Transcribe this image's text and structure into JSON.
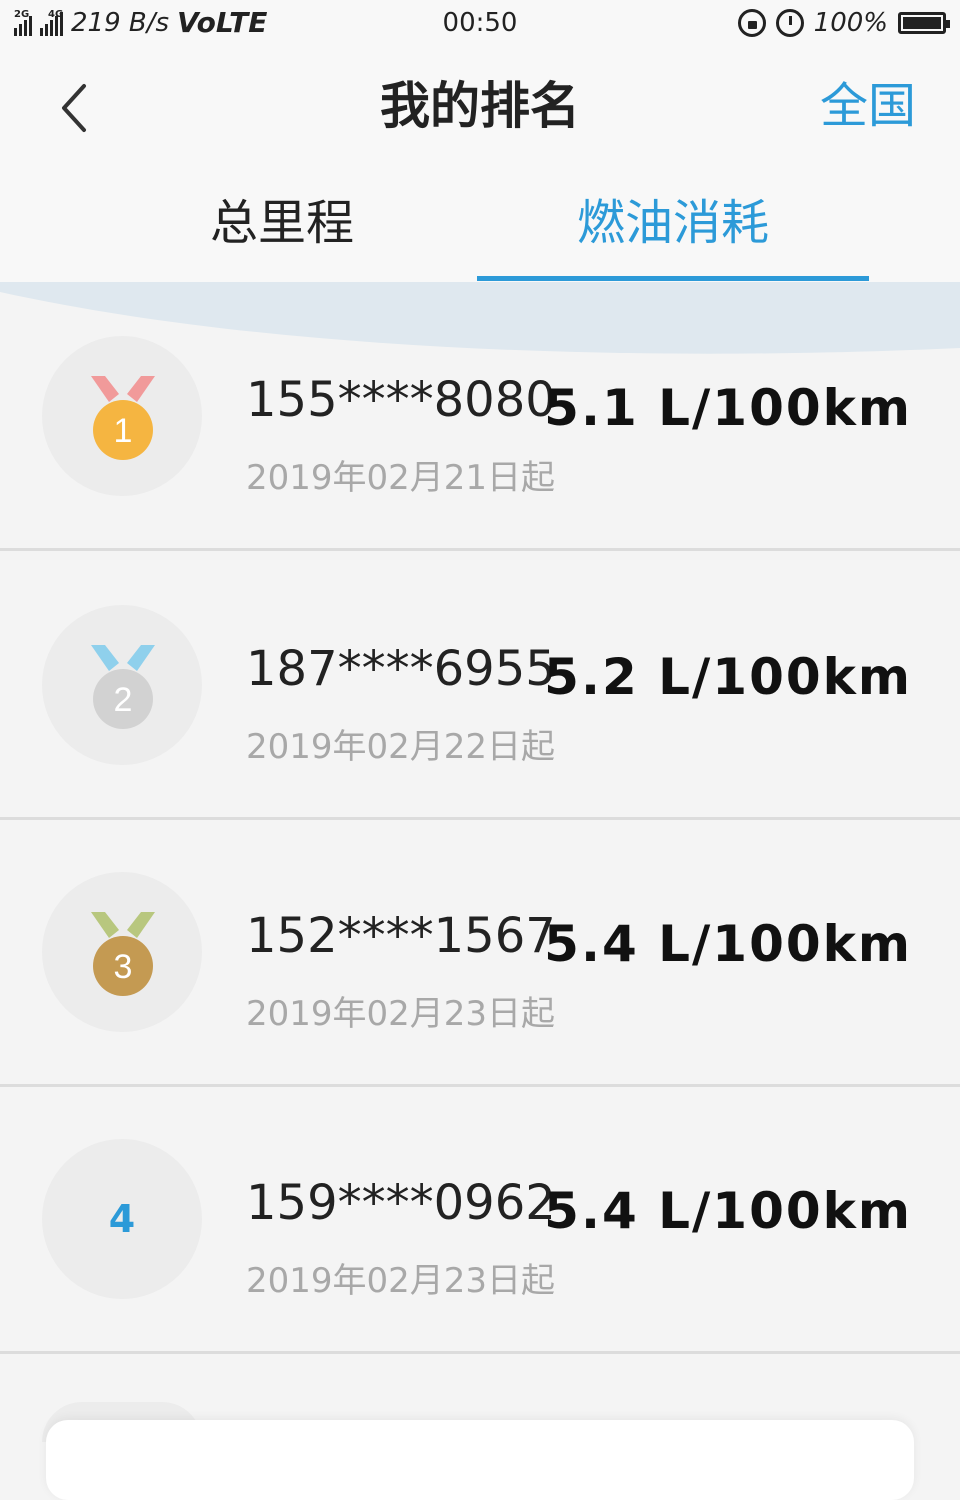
{
  "status_bar": {
    "network_labels": [
      "2G",
      "4G"
    ],
    "speed": "219 B/s",
    "volte": "VoLTE",
    "time": "00:50",
    "battery": "100%",
    "battery_level": 1.0
  },
  "header": {
    "back_icon": "chevron-left-icon",
    "title": "我的排名",
    "region_label": "全国"
  },
  "tabs": [
    {
      "label": "总里程",
      "active": false
    },
    {
      "label": "燃油消耗",
      "active": true
    }
  ],
  "colors": {
    "accent": "#2c9ad8",
    "gold": "#f5b541",
    "silver": "#d2d2d2",
    "bronze": "#c49a52"
  },
  "rankings": [
    {
      "rank": "1",
      "medal": "gold-medal-icon",
      "phone": "155****8080",
      "usage": "5.1 L/100km",
      "since": "2019年02月21日起"
    },
    {
      "rank": "2",
      "medal": "silver-medal-icon",
      "phone": "187****6955",
      "usage": "5.2 L/100km",
      "since": "2019年02月22日起"
    },
    {
      "rank": "3",
      "medal": "bronze-medal-icon",
      "phone": "152****1567",
      "usage": "5.4 L/100km",
      "since": "2019年02月23日起"
    },
    {
      "rank": "4",
      "medal": "",
      "phone": "159****0962",
      "usage": "5.4 L/100km",
      "since": "2019年02月23日起"
    }
  ]
}
